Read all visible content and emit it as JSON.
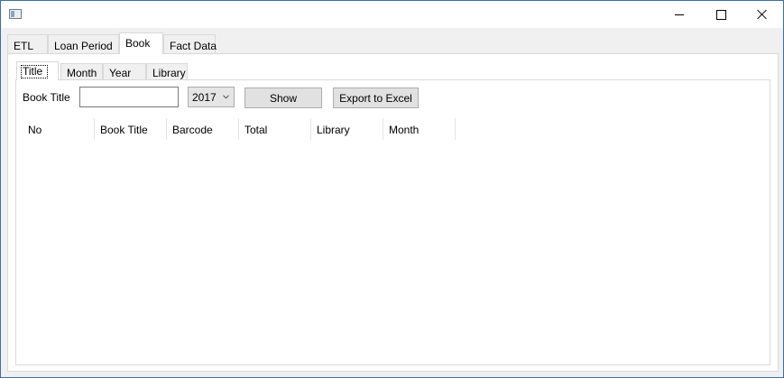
{
  "window": {
    "title": "",
    "minimize_icon": "minimize-icon",
    "maximize_icon": "maximize-icon",
    "close_icon": "close-icon"
  },
  "outer_tabs": [
    {
      "label": "ETL"
    },
    {
      "label": "Loan Period"
    },
    {
      "label": "Book"
    },
    {
      "label": "Fact Data"
    }
  ],
  "outer_tabs_selected": "Book",
  "inner_tabs": [
    {
      "label": "Title"
    },
    {
      "label": "Month"
    },
    {
      "label": "Year"
    },
    {
      "label": "Library"
    }
  ],
  "inner_tabs_selected": "Title",
  "filter": {
    "book_title_label": "Book Title",
    "book_title_value": "",
    "year_value": "2017",
    "show_label": "Show",
    "export_label": "Export to Excel"
  },
  "grid": {
    "columns": [
      "No",
      "Book Title",
      "Barcode",
      "Total",
      "Library",
      "Month"
    ],
    "rows": []
  }
}
